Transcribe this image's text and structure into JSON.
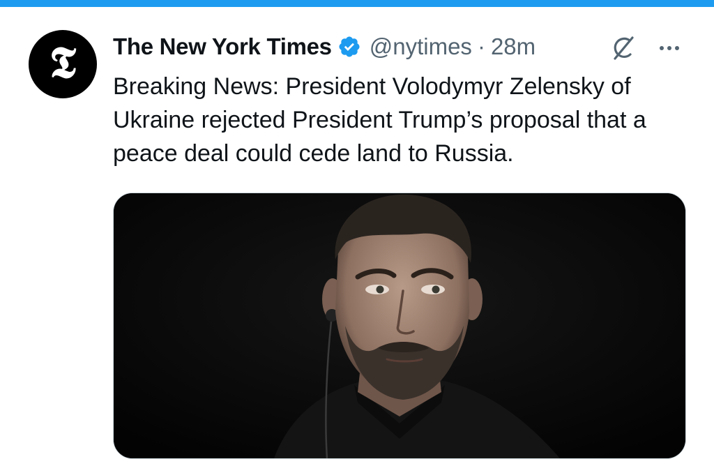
{
  "colors": {
    "accent": "#1d9bf0",
    "text": "#0f1419",
    "secondary": "#536471"
  },
  "tweet": {
    "author": {
      "display_name": "The New York Times",
      "handle": "@nytimes",
      "verified": true,
      "avatar_glyph": "𝕿"
    },
    "separator": "·",
    "time": "28m",
    "text": "Breaking News: President Volodymyr Zelensky of Ukraine rejected President Trump’s proposal that a peace deal could cede land to Russia.",
    "icons": {
      "verified": "verified-badge-icon",
      "grok": "grok-icon",
      "more": "more-icon"
    }
  }
}
